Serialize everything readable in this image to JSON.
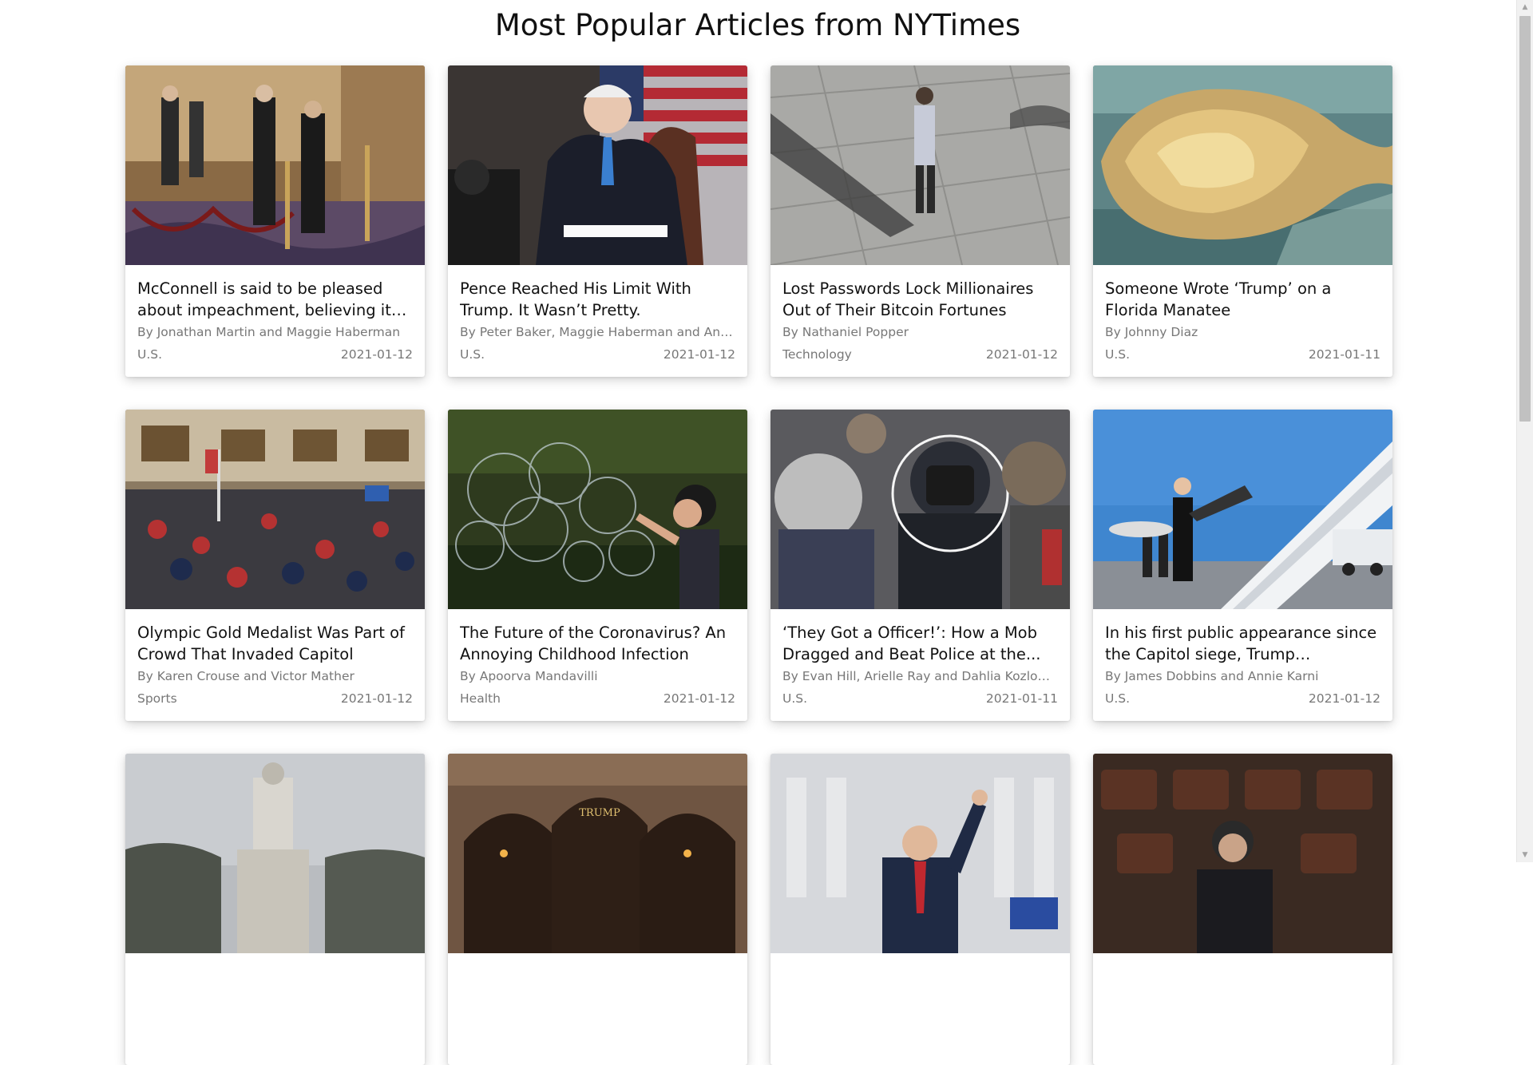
{
  "page": {
    "title": "Most Popular Articles from NYTimes"
  },
  "articles": [
    {
      "headline": "McConnell is said to be pleased about impeachment, believing it wi...",
      "byline": "By Jonathan Martin and Maggie Haberman",
      "section": "U.S.",
      "date": "2021-01-12",
      "image": "senate-hallway-photo"
    },
    {
      "headline": "Pence Reached His Limit With Trump. It Wasn’t Pretty.",
      "byline": "By Peter Baker, Maggie Haberman and Anni...",
      "section": "U.S.",
      "date": "2021-01-12",
      "image": "pence-podium-photo"
    },
    {
      "headline": "Lost Passwords Lock Millionaires Out of Their Bitcoin Fortunes",
      "byline": "By Nathaniel Popper",
      "section": "Technology",
      "date": "2021-01-12",
      "image": "man-standing-plaza-photo"
    },
    {
      "headline": "Someone Wrote ‘Trump’ on a Florida Manatee",
      "byline": "By Johnny Diaz",
      "section": "U.S.",
      "date": "2021-01-11",
      "image": "manatee-underwater-photo"
    },
    {
      "headline": "Olympic Gold Medalist Was Part of Crowd That Invaded Capitol",
      "byline": "By Karen Crouse and Victor Mather",
      "section": "Sports",
      "date": "2021-01-12",
      "image": "capitol-rotunda-crowd-photo"
    },
    {
      "headline": "The Future of the Coronavirus? An Annoying Childhood Infection",
      "byline": "By Apoorva Mandavilli",
      "section": "Health",
      "date": "2021-01-12",
      "image": "child-bubbles-photo"
    },
    {
      "headline": "‘They Got a Officer!’: How a Mob Dragged and Beat Police at the...",
      "byline": "By Evan Hill, Arielle Ray and Dahlia Kozlowsky",
      "section": "U.S.",
      "date": "2021-01-11",
      "image": "officer-mob-photo"
    },
    {
      "headline": "In his first public appearance since the Capitol siege, Trump expresses...",
      "byline": "By James Dobbins and Annie Karni",
      "section": "U.S.",
      "date": "2021-01-12",
      "image": "trump-airplane-photo"
    },
    {
      "headline": "",
      "byline": "",
      "section": "",
      "date": "",
      "image": "monument-photo"
    },
    {
      "headline": "",
      "byline": "",
      "section": "",
      "date": "",
      "image": "trump-hotel-photo"
    },
    {
      "headline": "",
      "byline": "",
      "section": "",
      "date": "",
      "image": "senator-fist-photo"
    },
    {
      "headline": "",
      "byline": "",
      "section": "",
      "date": "",
      "image": "chamber-seats-photo"
    }
  ],
  "thumb_text": {
    "hotel_sign": "TRUMP"
  }
}
